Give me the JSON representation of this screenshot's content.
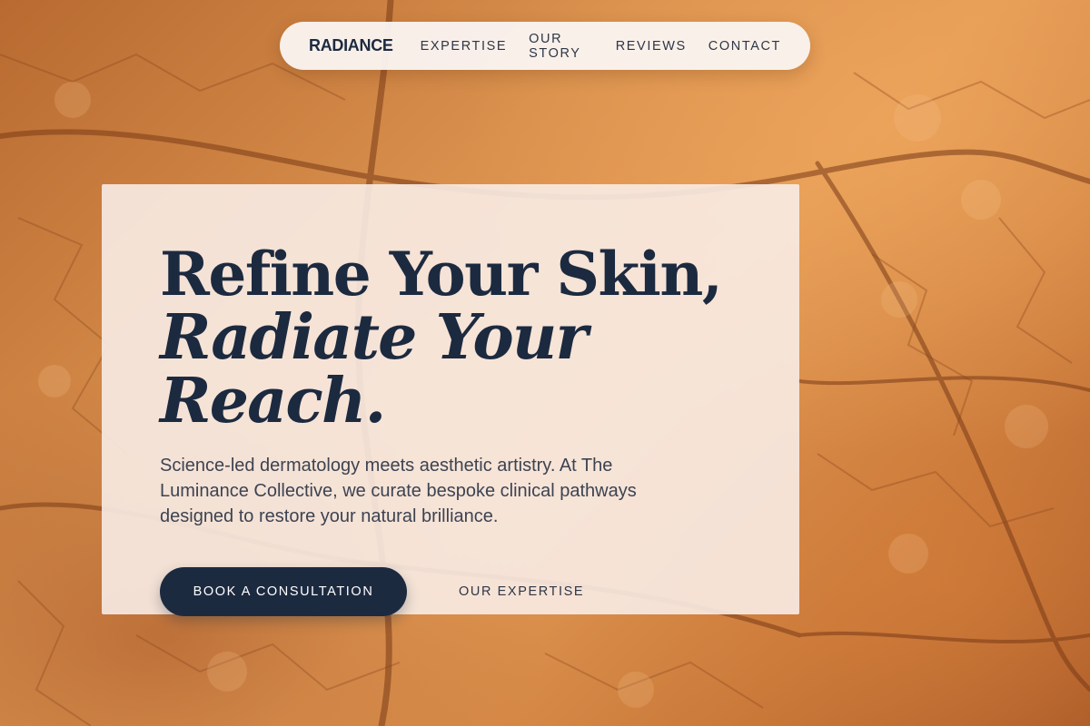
{
  "nav": {
    "brand": "RADIANCE",
    "links": [
      {
        "label": "EXPERTISE"
      },
      {
        "label": "OUR STORY"
      },
      {
        "label": "REVIEWS"
      },
      {
        "label": "CONTACT"
      }
    ]
  },
  "hero": {
    "headline_line1": "Refine Your Skin,",
    "headline_line2": "Radiate Your Reach.",
    "description": "Science-led dermatology meets aesthetic artistry. At The Luminance Collective, we curate bespoke clinical pathways designed to restore your natural brilliance.",
    "primary_cta": "BOOK A CONSULTATION",
    "secondary_cta": "OUR EXPERTISE"
  },
  "colors": {
    "navy": "#1c2a40",
    "card": "#f8ece6",
    "background": "#d9904d"
  }
}
